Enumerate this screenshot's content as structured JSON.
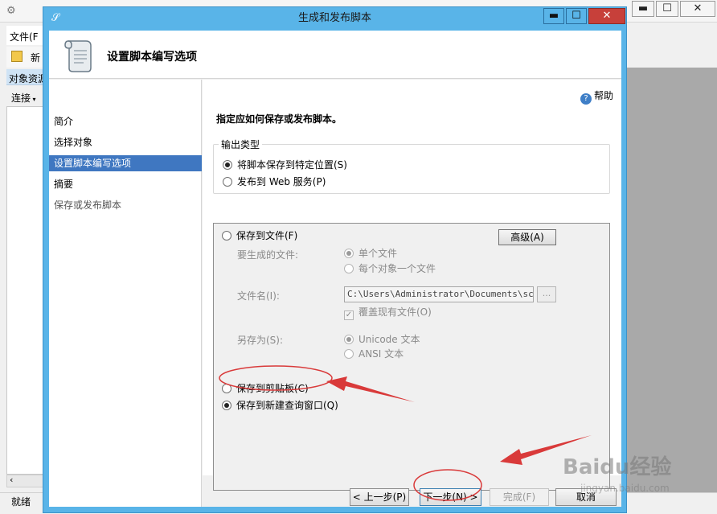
{
  "background_app": {
    "menu_file": "文件(F",
    "toolbar_new": "新",
    "object_explorer_title": "对象资源",
    "connect": "连接",
    "status": "就绪",
    "window_buttons": {
      "minimize": "▬",
      "maximize": "☐",
      "close": "✕"
    }
  },
  "dialog": {
    "title": "生成和发布脚本",
    "window_buttons": {
      "minimize": "▬",
      "maximize": "☐",
      "close": "✕"
    },
    "header_title": "设置脚本编写选项",
    "help": "帮助",
    "nav": [
      {
        "label": "简介",
        "state": "normal"
      },
      {
        "label": "选择对象",
        "state": "normal"
      },
      {
        "label": "设置脚本编写选项",
        "state": "active"
      },
      {
        "label": "摘要",
        "state": "normal"
      },
      {
        "label": "保存或发布脚本",
        "state": "disabled"
      }
    ],
    "prompt": "指定应如何保存或发布脚本。",
    "output_type": {
      "legend": "输出类型",
      "options": [
        "将脚本保存到特定位置(S)",
        "发布到 Web 服务(P)"
      ],
      "selected": 0
    },
    "save_options": {
      "to_file": "保存到文件(F)",
      "advanced_button": "高级(A)",
      "files_to_generate_label": "要生成的文件:",
      "files_options": [
        "单个文件",
        "每个对象一个文件"
      ],
      "file_name_label": "文件名(I):",
      "file_name_value": "C:\\Users\\Administrator\\Documents\\script",
      "browse": "...",
      "overwrite": "覆盖现有文件(O)",
      "save_as_label": "另存为(S):",
      "save_as_options": [
        "Unicode 文本",
        "ANSI 文本"
      ],
      "to_clipboard": "保存到剪贴板(C)",
      "to_new_query": "保存到新建查询窗口(Q)",
      "selected": "to_new_query"
    },
    "footer": {
      "previous": "< 上一步(P)",
      "next": "下一步(N) >",
      "finish": "完成(F)",
      "cancel": "取消"
    }
  },
  "watermark": {
    "brand": "Baidu经验",
    "url": "jingyan.baidu.com"
  },
  "colors": {
    "dialog_frame": "#59b4e8",
    "nav_active": "#3f77c1",
    "annotation": "#d93a3a",
    "close_button": "#c7403a"
  }
}
